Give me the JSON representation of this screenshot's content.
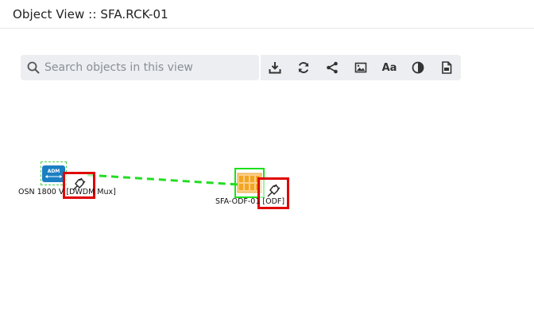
{
  "header": {
    "title": "Object View :: SFA.RCK-01"
  },
  "search": {
    "placeholder": "Search objects in this view"
  },
  "toolbar": {
    "buttons": [
      {
        "name": "download-icon"
      },
      {
        "name": "refresh-icon"
      },
      {
        "name": "share-icon"
      },
      {
        "name": "image-icon"
      },
      {
        "name": "font-icon",
        "label": "Aa"
      },
      {
        "name": "contrast-icon"
      },
      {
        "name": "pdf-icon"
      }
    ]
  },
  "nodes": {
    "left": {
      "label": "OSN 1800 V [DWDM Mux]",
      "badge": "ADM"
    },
    "right": {
      "label": "SFA-ODF-01 [ODF]"
    }
  },
  "colors": {
    "link": "#22dd22",
    "highlight": "#e00000",
    "selection": "#1de01d",
    "adm": "#1b7fc2",
    "odf": "#f6b23a"
  }
}
